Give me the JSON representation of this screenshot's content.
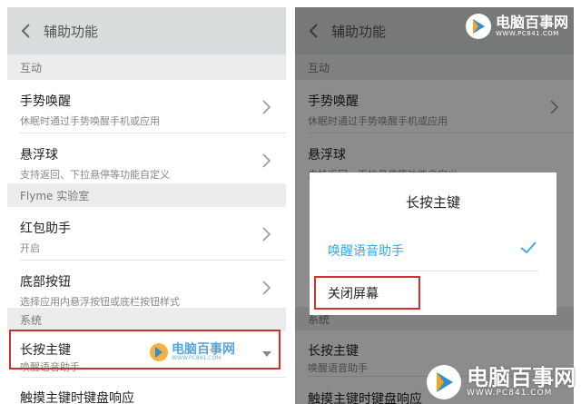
{
  "left": {
    "header_title": "辅助功能",
    "sections": [
      {
        "label": "互动"
      },
      {
        "label": "Flyme 实验室"
      },
      {
        "label": "系统"
      }
    ],
    "items": [
      {
        "title": "手势唤醒",
        "subtitle": "休眠时通过手势唤醒手机或应用"
      },
      {
        "title": "悬浮球",
        "subtitle": "支持返回、下拉悬停等功能自定义"
      },
      {
        "title": "红包助手",
        "subtitle": "开启"
      },
      {
        "title": "底部按钮",
        "subtitle": "选择应用内悬浮按钮或底栏按钮样式"
      },
      {
        "title": "长按主键",
        "subtitle": "唤醒语音助手"
      },
      {
        "title": "触摸主键时键盘响应",
        "subtitle": ""
      }
    ],
    "watermark_text": "电脑百事网",
    "watermark_url": "WWW.PC841.COM"
  },
  "right": {
    "header_title": "辅助功能",
    "sections": [
      {
        "label": "互动"
      },
      {
        "label": "系统"
      }
    ],
    "items": [
      {
        "title": "手势唤醒",
        "subtitle": "休眠时通过手势唤醒手机或应用"
      },
      {
        "title": "悬浮球",
        "subtitle": "支持返回、下拉悬停等功能自定义"
      },
      {
        "title": "长按主键",
        "subtitle": "唤醒语音助手"
      },
      {
        "title": "触摸主键时键盘响应",
        "subtitle": ""
      }
    ],
    "dialog": {
      "title": "长按主键",
      "options": [
        {
          "label": "唤醒语音助手",
          "selected": true
        },
        {
          "label": "关闭屏幕",
          "selected": false
        }
      ]
    },
    "top_logo_text": "电脑百事网",
    "top_logo_url": "WWW.PC841.COM"
  },
  "bottom_logo_text": "电脑百事网",
  "bottom_logo_url": "WWW.PC841.COM",
  "colors": {
    "accent": "#3aa8d8",
    "highlight_box": "#d32f2f",
    "header": "#d9dddd",
    "section_bg": "#ececec"
  },
  "icons": [
    "back-chevron-icon",
    "chevron-right-icon",
    "dropdown-arrow-icon",
    "checkmark-icon",
    "pc841-logo-icon"
  ]
}
